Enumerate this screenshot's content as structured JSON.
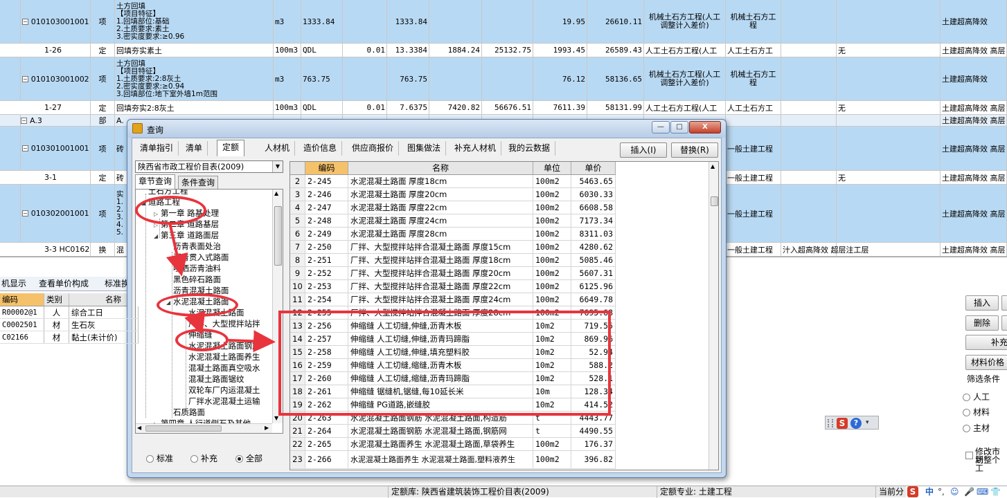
{
  "bg_grid": {
    "rows": [
      {
        "style": "blue",
        "h": 63,
        "expander": true,
        "code": "010103001001",
        "type": "项",
        "desc": [
          "土方回填",
          "【项目特征】",
          "1.回填部位:基础",
          "2.土质要求:素土",
          "3.密实度要求:≥0.96"
        ],
        "unit": "m3",
        "expr": "1333.84",
        "qty_coef": "",
        "qty": "1333.84",
        "c1": "",
        "c2": "",
        "c3": "19.95",
        "c4": "26610.11",
        "prof1": "机械土石方工程(人工调整计入差价)",
        "prof2": "机械土石方工程",
        "z": "",
        "extra": "",
        "right": "土建超高降效"
      },
      {
        "style": "white",
        "h": 20,
        "expander": false,
        "code": "1-26",
        "type": "定",
        "desc": [
          "回填夯实素土"
        ],
        "unit": "100m3",
        "expr": "QDL",
        "qty_coef": "0.01",
        "qty": "13.3384",
        "c1": "1884.24",
        "c2": "25132.75",
        "c3": "1993.45",
        "c4": "26589.43",
        "prof1": "人工土石方工程(人工",
        "prof2": "人工土石方工",
        "z": "无",
        "extra": "",
        "right": "土建超高降效 高层"
      },
      {
        "style": "blue",
        "h": 63,
        "expander": true,
        "code": "010103001002",
        "type": "项",
        "desc": [
          "土方回填",
          "【项目特征】",
          "1.土质要求:2:8灰土",
          "2.密实度要求:≥0.94",
          "3.回填部位:地下室外墙1m范围"
        ],
        "unit": "m3",
        "expr": "763.75",
        "qty_coef": "",
        "qty": "763.75",
        "c1": "",
        "c2": "",
        "c3": "76.12",
        "c4": "58136.65",
        "prof1": "机械土石方工程(人工调整计入差价)",
        "prof2": "机械土石方工程",
        "z": "",
        "extra": "",
        "right": "土建超高降效"
      },
      {
        "style": "white",
        "h": 20,
        "expander": false,
        "code": "1-27",
        "type": "定",
        "desc": [
          "回填夯实2:8灰土"
        ],
        "unit": "100m3",
        "expr": "QDL",
        "qty_coef": "0.01",
        "qty": "7.6375",
        "c1": "7420.82",
        "c2": "56676.51",
        "c3": "7611.39",
        "c4": "58131.99",
        "prof1": "人工土石方工程(人工",
        "prof2": "人工土石方工",
        "z": "无",
        "extra": "",
        "right": "土建超高降效 高层"
      },
      {
        "style": "light",
        "h": 17,
        "expander": true,
        "code": "A.3",
        "type": "部",
        "desc": [
          "A."
        ],
        "unit": "",
        "expr": "",
        "qty_coef": "",
        "qty": "",
        "c1": "",
        "c2": "",
        "c3": "",
        "c4": "",
        "prof1": "",
        "prof2": "",
        "z": "",
        "extra": "",
        "right": "土建超高降效 高层"
      },
      {
        "style": "blue",
        "h": 64,
        "expander": true,
        "code": "010301001001",
        "type": "项",
        "desc": [
          "砖"
        ],
        "unit": "",
        "expr": "",
        "qty_coef": "",
        "qty": "",
        "c1": "",
        "c2": "",
        "c3": "",
        "c4": "",
        "prof1": "",
        "prof2": "一般土建工程",
        "z": "",
        "extra": "",
        "right": "土建超高降效 高层"
      },
      {
        "style": "white",
        "h": 20,
        "expander": false,
        "code": "3-1",
        "type": "定",
        "desc": [
          "砖"
        ],
        "unit": "",
        "expr": "",
        "qty_coef": "",
        "qty": "",
        "c1": "",
        "c2": "",
        "c3": "",
        "c4": "",
        "prof1": "",
        "prof2": "一般土建工程",
        "z": "无",
        "extra": "",
        "right": "土建超高降效 高层"
      },
      {
        "style": "blue",
        "h": 84,
        "expander": true,
        "code": "010302001001",
        "type": "项",
        "desc": [
          "实",
          "1.",
          "2.",
          "3.",
          "4.",
          "5."
        ],
        "unit": "",
        "expr": "",
        "qty_coef": "",
        "qty": "",
        "c1": "",
        "c2": "",
        "c3": "",
        "c4": "",
        "prof1": "",
        "prof2": "一般土建工程",
        "z": "",
        "extra": "",
        "right": "土建超高降效 高层"
      },
      {
        "style": "white",
        "h": 20,
        "expander": false,
        "code": "3-3 HC0162",
        "type": "换",
        "desc": [
          "混"
        ],
        "unit": "",
        "expr": "",
        "qty_coef": "",
        "qty": "",
        "c1": "",
        "c2": "",
        "c3": "",
        "c4": "",
        "prof1": "",
        "prof2": "一般土建工程",
        "z": "",
        "extra": "汁入超高降效 超层注工层",
        "right": "土建超高降效 高层"
      }
    ]
  },
  "lower_tabs": [
    "机显示",
    "查看单价构成",
    "标准换"
  ],
  "resource_table": {
    "headers": [
      "编码",
      "类别",
      "名称"
    ],
    "rows": [
      {
        "code": "R00002@1",
        "cat": "人",
        "name": "综合工日"
      },
      {
        "code": "C0002501",
        "cat": "材",
        "name": "生石灰"
      },
      {
        "code": "C02166",
        "cat": "材",
        "name": "黏土(未计价)"
      }
    ]
  },
  "right_panel": {
    "insert": "插入",
    "delete": "删除",
    "supplement": "补充",
    "material_price": "材料价格",
    "filter_title": "筛选条件",
    "filters": [
      "人工",
      "材料",
      "主材"
    ],
    "modify_check": "修改市场",
    "modify_check2": "到整个工"
  },
  "status_bar": {
    "lib_label": "定额库:",
    "lib_value": "陕西省建筑装饰工程价目表(2009)",
    "major_label": "定额专业:",
    "major_value": "土建工程",
    "current": "当前分",
    "ime_lang": "中"
  },
  "dialog": {
    "title": "查询",
    "window_buttons": {
      "minimize": "—",
      "maximize": "□",
      "close": "X"
    },
    "tabs": [
      "清单指引",
      "清单",
      "定额",
      "人材机",
      "造价信息",
      "供应商报价",
      "图集做法",
      "补充人材机",
      "我的云数据"
    ],
    "active_tab": "定额",
    "insert_button": "插入(I)",
    "replace_button": "替换(R)",
    "library": "陕西省市政工程价目表(2009)",
    "subtabs": [
      "章节查询",
      "条件查询"
    ],
    "tree": [
      {
        "label": "土石方工程",
        "level": 1,
        "toggle": ""
      },
      {
        "label": "道路工程",
        "level": 1,
        "toggle": "◢"
      },
      {
        "label": "第一章 路基处理",
        "level": 2,
        "toggle": "▷"
      },
      {
        "label": "第二章 道路基层",
        "level": 2,
        "toggle": "▷"
      },
      {
        "label": "第三章 道路面层",
        "level": 2,
        "toggle": "◢"
      },
      {
        "label": "沥青表面处治",
        "level": 3,
        "toggle": ""
      },
      {
        "label": "沥青贯入式路面",
        "level": 3,
        "toggle": ""
      },
      {
        "label": "喷洒沥青油料",
        "level": 3,
        "toggle": ""
      },
      {
        "label": "黑色碎石路面",
        "level": 3,
        "toggle": ""
      },
      {
        "label": "沥青混凝土路面",
        "level": 3,
        "toggle": ""
      },
      {
        "label": "水泥混凝土路面",
        "level": 3,
        "toggle": "◢"
      },
      {
        "label": "水泥混凝土路面",
        "level": 4,
        "toggle": ""
      },
      {
        "label": "厂拌、大型搅拌站拌",
        "level": 4,
        "toggle": ""
      },
      {
        "label": "伸缩缝",
        "level": 4,
        "toggle": ""
      },
      {
        "label": "水泥混凝土路面钢筋",
        "level": 4,
        "toggle": ""
      },
      {
        "label": "水泥混凝土路面养生",
        "level": 4,
        "toggle": ""
      },
      {
        "label": "混凝土路面真空吸水",
        "level": 4,
        "toggle": ""
      },
      {
        "label": "混凝土路面锯纹",
        "level": 4,
        "toggle": ""
      },
      {
        "label": "双轮车厂内运混凝土",
        "level": 4,
        "toggle": ""
      },
      {
        "label": "厂拌水泥混凝土运输",
        "level": 4,
        "toggle": ""
      },
      {
        "label": "石质路面",
        "level": 3,
        "toggle": ""
      },
      {
        "label": "第四章 人行道侧石及其他",
        "level": 2,
        "toggle": "▷"
      }
    ],
    "filter_radios": [
      "标准",
      "补充",
      "全部"
    ],
    "filter_selected": "全部",
    "grid": {
      "headers": [
        "",
        "编码",
        "名称",
        "单位",
        "单价"
      ],
      "rows": [
        {
          "n": "2",
          "code": "2-245",
          "name": "水泥混凝土路面 厚度18cm",
          "unit": "100m2",
          "price": "5463.65"
        },
        {
          "n": "3",
          "code": "2-246",
          "name": "水泥混凝土路面 厚度20cm",
          "unit": "100m2",
          "price": "6030.33"
        },
        {
          "n": "4",
          "code": "2-247",
          "name": "水泥混凝土路面 厚度22cm",
          "unit": "100m2",
          "price": "6608.58"
        },
        {
          "n": "5",
          "code": "2-248",
          "name": "水泥混凝土路面 厚度24cm",
          "unit": "100m2",
          "price": "7173.34"
        },
        {
          "n": "6",
          "code": "2-249",
          "name": "水泥混凝土路面 厚度28cm",
          "unit": "100m2",
          "price": "8311.03"
        },
        {
          "n": "7",
          "code": "2-250",
          "name": "厂拌、大型搅拌站拌合混凝土路面 厚度15cm",
          "unit": "100m2",
          "price": "4280.62"
        },
        {
          "n": "8",
          "code": "2-251",
          "name": "厂拌、大型搅拌站拌合混凝土路面 厚度18cm",
          "unit": "100m2",
          "price": "5085.46"
        },
        {
          "n": "9",
          "code": "2-252",
          "name": "厂拌、大型搅拌站拌合混凝土路面 厚度20cm",
          "unit": "100m2",
          "price": "5607.31"
        },
        {
          "n": "10",
          "code": "2-253",
          "name": "厂拌、大型搅拌站拌合混凝土路面 厚度22cm",
          "unit": "100m2",
          "price": "6125.96"
        },
        {
          "n": "11",
          "code": "2-254",
          "name": "厂拌、大型搅拌站拌合混凝土路面 厚度24cm",
          "unit": "100m2",
          "price": "6649.78"
        },
        {
          "n": "12",
          "code": "2-255",
          "name": "厂拌、大型搅拌站拌合混凝土路面 厚度28cm",
          "unit": "100m2",
          "price": "7695.68"
        },
        {
          "n": "13",
          "code": "2-256",
          "name": "伸缩缝 人工切缝,伸缝,沥青木板",
          "unit": "10m2",
          "price": "719.55"
        },
        {
          "n": "14",
          "code": "2-257",
          "name": "伸缩缝 人工切缝,伸缝,沥青玛蹄脂",
          "unit": "10m2",
          "price": "869.96"
        },
        {
          "n": "15",
          "code": "2-258",
          "name": "伸缩缝 人工切缝,伸缝,填充塑料胶",
          "unit": "10m2",
          "price": "52.94"
        },
        {
          "n": "16",
          "code": "2-259",
          "name": "伸缩缝 人工切缝,缩缝,沥青木板",
          "unit": "10m2",
          "price": "588.2"
        },
        {
          "n": "17",
          "code": "2-260",
          "name": "伸缩缝 人工切缝,缩缝,沥青玛蹄脂",
          "unit": "10m2",
          "price": "528.1"
        },
        {
          "n": "18",
          "code": "2-261",
          "name": "伸缩缝 锯缝机,锯缝,每10延长米",
          "unit": "10m",
          "price": "128.34"
        },
        {
          "n": "19",
          "code": "2-262",
          "name": "伸缩缝 PG道路,嵌缝胶",
          "unit": "10m2",
          "price": "414.52"
        },
        {
          "n": "20",
          "code": "2-263",
          "name": "水泥混凝土路面钢筋 水泥混凝土路面,构造筋",
          "unit": "t",
          "price": "4443.77"
        },
        {
          "n": "21",
          "code": "2-264",
          "name": "水泥混凝土路面钢筋 水泥混凝土路面,钢筋网",
          "unit": "t",
          "price": "4490.55"
        },
        {
          "n": "22",
          "code": "2-265",
          "name": "水泥混凝土路面养生 水泥混凝土路面,草袋养生",
          "unit": "100m2",
          "price": "176.37"
        },
        {
          "n": "23",
          "code": "2-266",
          "name": "水泥混凝土路面养生 水泥混凝土路面,塑料液养生",
          "unit": "100m2",
          "price": "396.82"
        }
      ]
    }
  }
}
